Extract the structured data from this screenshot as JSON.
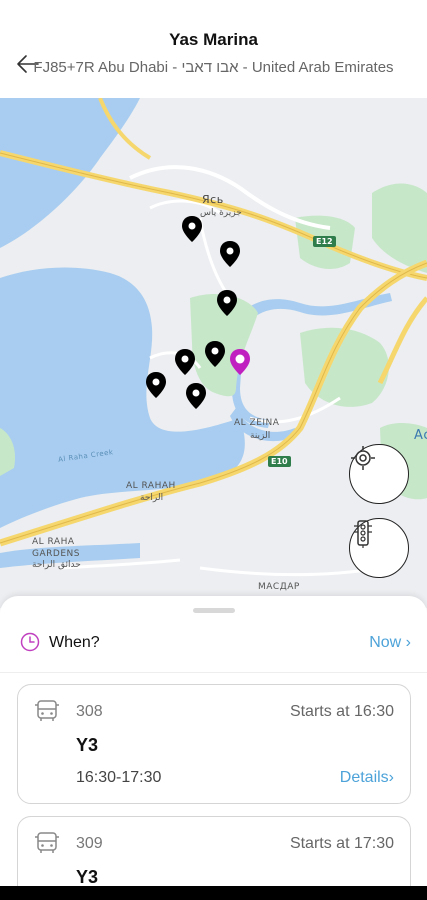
{
  "header": {
    "title": "Yas Marina",
    "subtitle": "FJ85+7R Abu Dhabi - אבו דאבי - United Arab Emirates"
  },
  "map": {
    "labels": {
      "yas_latin": "Ясь",
      "yas_arabic": "جزيرة ياس",
      "e12": "E12",
      "e10": "E10",
      "al_zeina": "AL ZEINA",
      "al_zeina_arabic": "الزينة",
      "al_raha": "AL RAHAH",
      "al_raha_arabic": "الراحة",
      "al_raha_gardens": "AL RAHA\nGARDENS",
      "al_raha_gardens_arabic": "حدائق الراحة",
      "creek": "Al Raha Creek",
      "masdar": "МАСДАР",
      "edge": "Ас"
    },
    "colors": {
      "water": "#a8cdf0",
      "land": "#eceef1",
      "park": "#c7e7c9",
      "highway": "#f5d76e",
      "highlight_pin": "#c020c0"
    }
  },
  "buttons": {
    "locate_icon": "locate-target-icon",
    "traffic_icon": "traffic-light-icon"
  },
  "sheet": {
    "when_label": "When?",
    "now_label": "Now ›",
    "trips": [
      {
        "route": "308",
        "starts": "Starts at 16:30",
        "line": "Y3",
        "time_range": "16:30-17:30",
        "details": "Details›"
      },
      {
        "route": "309",
        "starts": "Starts at 17:30",
        "line": "Y3"
      }
    ]
  }
}
